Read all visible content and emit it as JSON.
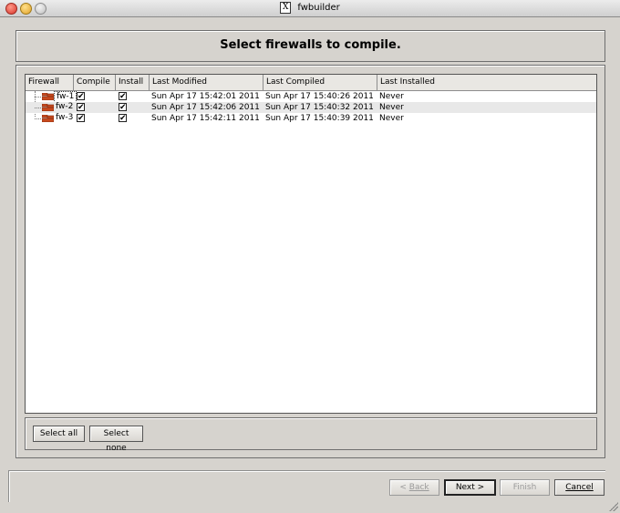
{
  "window": {
    "title": "fwbuilder",
    "x_icon_glyph": "X"
  },
  "header": {
    "title": "Select firewalls to compile."
  },
  "table": {
    "columns": [
      "Firewall",
      "Compile",
      "Install",
      "Last Modified",
      "Last Compiled",
      "Last Installed"
    ],
    "rows": [
      {
        "firewall": "fw-1",
        "compile": true,
        "install": true,
        "last_modified": "Sun Apr 17 15:42:01 2011",
        "last_compiled": "Sun Apr 17 15:40:26 2011",
        "last_installed": "Never"
      },
      {
        "firewall": "fw-2",
        "compile": true,
        "install": true,
        "last_modified": "Sun Apr 17 15:42:06 2011",
        "last_compiled": "Sun Apr 17 15:40:32 2011",
        "last_installed": "Never"
      },
      {
        "firewall": "fw-3",
        "compile": true,
        "install": true,
        "last_modified": "Sun Apr 17 15:42:11 2011",
        "last_compiled": "Sun Apr 17 15:40:39 2011",
        "last_installed": "Never"
      }
    ],
    "check_glyph": "✔"
  },
  "selection_buttons": {
    "select_all": "Select all",
    "select_none": "Select none"
  },
  "wizard_buttons": {
    "back_arrow": "< ",
    "back_label": "Back",
    "next_label": "Next >",
    "finish_label": "Finish",
    "cancel_label": "Cancel"
  },
  "colors": {
    "firewall_icon": "#c8491e",
    "window_bg": "#d6d3ce"
  }
}
